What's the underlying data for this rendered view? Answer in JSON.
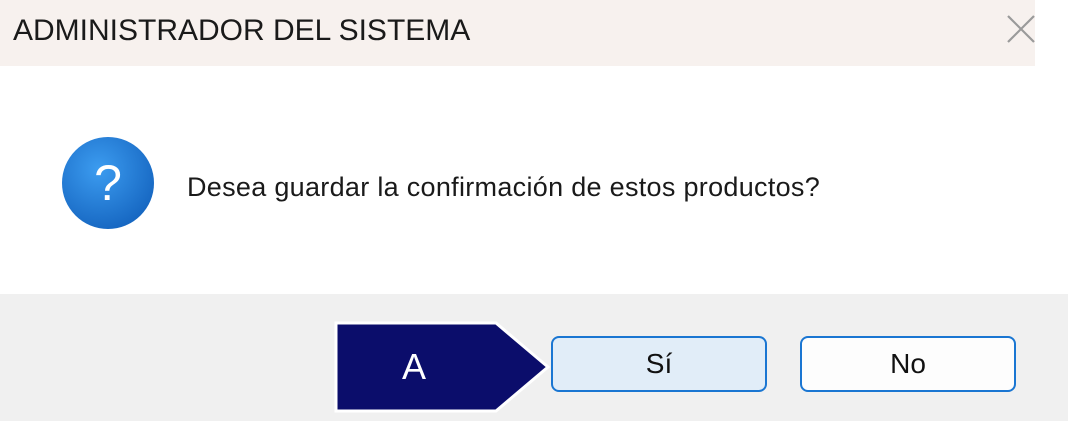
{
  "window": {
    "title": "ADMINISTRADOR DEL SISTEMA",
    "close_icon": "close-icon"
  },
  "dialog": {
    "icon": "question-icon",
    "icon_color": "#1e88e5",
    "message": "Desea guardar la confirmación de estos productos?"
  },
  "buttons": {
    "yes_label": "Sí",
    "no_label": "No",
    "accent": "#1a76d2"
  },
  "annotation": {
    "label": "A",
    "color": "#0b0d6b",
    "points_to": "yes-button"
  }
}
